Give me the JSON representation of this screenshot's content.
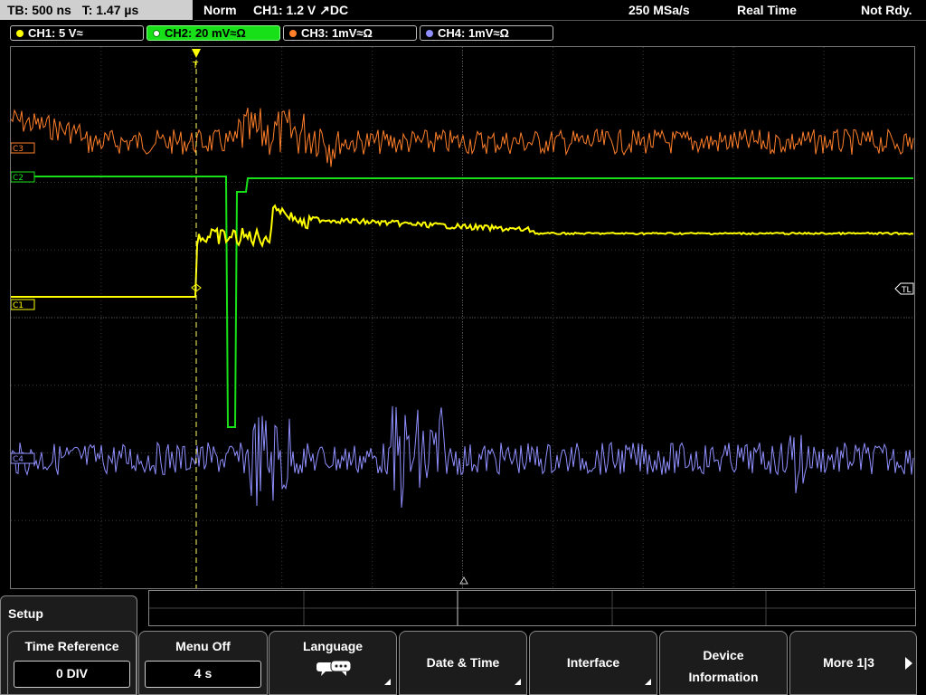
{
  "status": {
    "timebase": "TB: 500 ns",
    "trigger_time": "T: 1.47 µs",
    "mode": "Norm",
    "trigger_info": "CH1: 1.2 V ↗DC",
    "sample_rate": "250 MSa/s",
    "acq_mode": "Real Time",
    "state": "Not Rdy."
  },
  "channels": [
    {
      "label": "CH1: 5 V≈",
      "color": "#ffff00",
      "active": false
    },
    {
      "label": "CH2: 20 mV≈Ω",
      "color": "#18e018",
      "active": true
    },
    {
      "label": "CH3: 1mV≈Ω",
      "color": "#ff7f2a",
      "active": false
    },
    {
      "label": "CH4: 1mV≈Ω",
      "color": "#8f8fff",
      "active": false
    }
  ],
  "markers": {
    "c1": "C1",
    "c2": "C2",
    "c3": "C3",
    "c4": "C4",
    "trigger_level": "TL",
    "trigger_pos": "T"
  },
  "menu": {
    "title": "Setup",
    "softkeys": [
      {
        "label": "Time Reference",
        "value": "0 DIV"
      },
      {
        "label": "Menu Off",
        "value": "4 s"
      },
      {
        "label": "Language",
        "icon": "speech-bubble-icon"
      },
      {
        "label": "Date & Time"
      },
      {
        "label": "Interface"
      },
      {
        "label": "Device Information",
        "line1": "Device",
        "line2": "Information"
      },
      {
        "label": "More 1|3"
      }
    ]
  },
  "colors": {
    "ch1": "#ffff00",
    "ch2": "#18e018",
    "ch3": "#ff7f2a",
    "ch4": "#8f8fff",
    "grid": "#5a5a5a"
  }
}
